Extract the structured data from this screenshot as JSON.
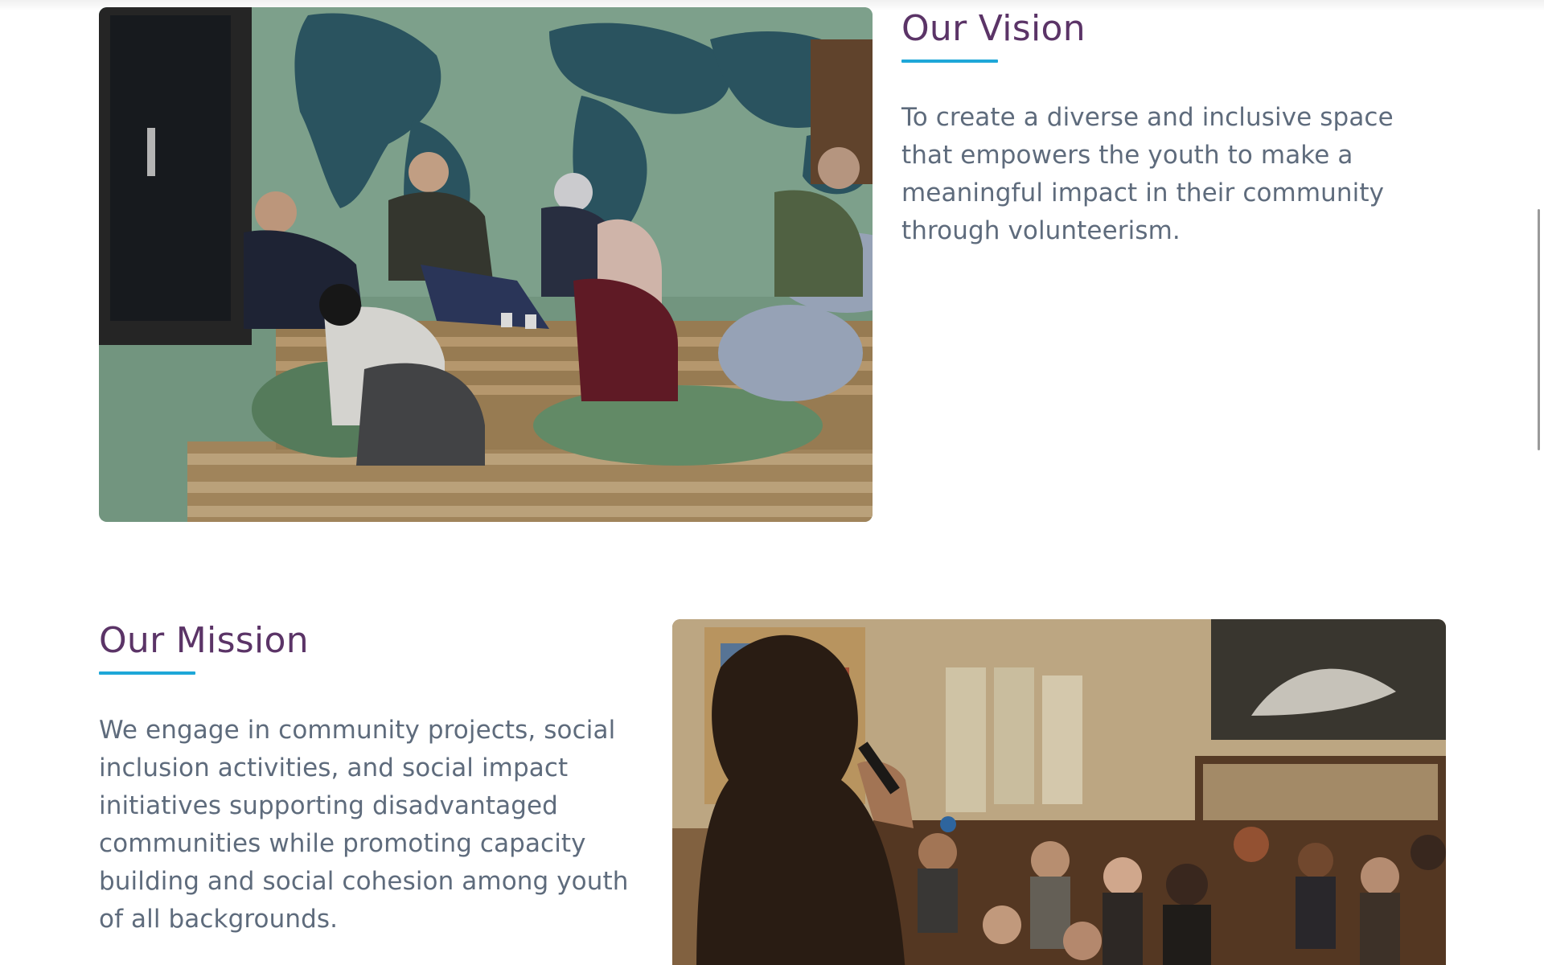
{
  "vision": {
    "title": "Our Vision",
    "body": "To create a diverse and inclusive space that empowers the youth to make a meaningful impact in their community through volunteerism."
  },
  "mission": {
    "title": "Our Mission",
    "body": "We engage in community projects, social inclusion activities, and social impact initiatives supporting disadvantaged communities while promoting capacity building and social cohesion among youth of all backgrounds."
  },
  "colors": {
    "heading": "#5b3467",
    "accent_underline": "#1ea7d8",
    "body_text": "#5e6b7c"
  }
}
